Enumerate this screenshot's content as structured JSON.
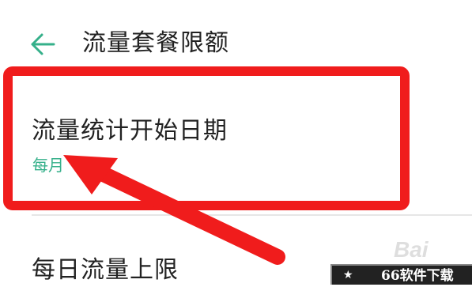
{
  "header": {
    "back_icon": "arrow-left-icon",
    "title": "流量套餐限额"
  },
  "settings": {
    "items": [
      {
        "title": "流量统计开始日期",
        "subtitle": "每月"
      },
      {
        "title": "每日流量上限"
      }
    ]
  },
  "annotations": {
    "highlight_color": "#f01c1c"
  },
  "watermarks": {
    "baidu": "Bai",
    "site_star": "★",
    "site": "66软件下载"
  },
  "colors": {
    "accent": "#35b08a",
    "text": "#222222",
    "divider": "#e6e6e6"
  }
}
